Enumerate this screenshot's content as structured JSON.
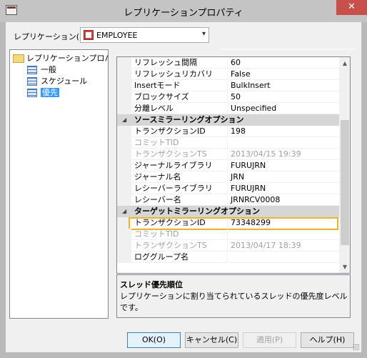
{
  "window": {
    "title": "レプリケーションプロパティ",
    "close_glyph": "✕"
  },
  "replication": {
    "label": "レプリケーション(R)",
    "selected": "EMPLOYEE"
  },
  "tree": {
    "root": "レプリケーションプロパティ",
    "items": [
      "一般",
      "スケジュール",
      "優先"
    ],
    "selected_index": 2
  },
  "properties": [
    {
      "type": "row",
      "name": "リフレッシュ間隔",
      "value": "60"
    },
    {
      "type": "row",
      "name": "リフレッシュリカバリ",
      "value": "False"
    },
    {
      "type": "row",
      "name": "Insertモード",
      "value": "BulkInsert"
    },
    {
      "type": "row",
      "name": "ブロックサイズ",
      "value": "50"
    },
    {
      "type": "row",
      "name": "分離レベル",
      "value": "Unspecified"
    },
    {
      "type": "category",
      "name": "ソースミラーリングオプション"
    },
    {
      "type": "row",
      "name": "トランザクションID",
      "value": "198"
    },
    {
      "type": "row",
      "name": "コミットTID",
      "value": "",
      "disabled": true
    },
    {
      "type": "row",
      "name": "トランザクションTS",
      "value": "2013/04/15 19:39",
      "disabled": true
    },
    {
      "type": "row",
      "name": "ジャーナルライブラリ",
      "value": "FURUJRN"
    },
    {
      "type": "row",
      "name": "ジャーナル名",
      "value": "JRN"
    },
    {
      "type": "row",
      "name": "レシーバーライブラリ",
      "value": "FURUJRN"
    },
    {
      "type": "row",
      "name": "レシーバー名",
      "value": "JRNRCV0008"
    },
    {
      "type": "category",
      "name": "ターゲットミラーリングオプション"
    },
    {
      "type": "row",
      "name": "トランザクションID",
      "value": "73348299",
      "highlighted": true
    },
    {
      "type": "row",
      "name": "コミットTID",
      "value": "",
      "disabled": true
    },
    {
      "type": "row",
      "name": "トランザクションTS",
      "value": "2013/04/17 18:39",
      "disabled": true
    },
    {
      "type": "row",
      "name": "ロググループ名",
      "value": ""
    }
  ],
  "description": {
    "title": "スレッド優先順位",
    "text": "レプリケーションに割り当てられているスレッドの優先度レベルです。"
  },
  "buttons": {
    "ok": "OK(O)",
    "cancel": "キャンセル(C)",
    "apply": "適用(P)",
    "help": "ヘルプ(H)"
  }
}
